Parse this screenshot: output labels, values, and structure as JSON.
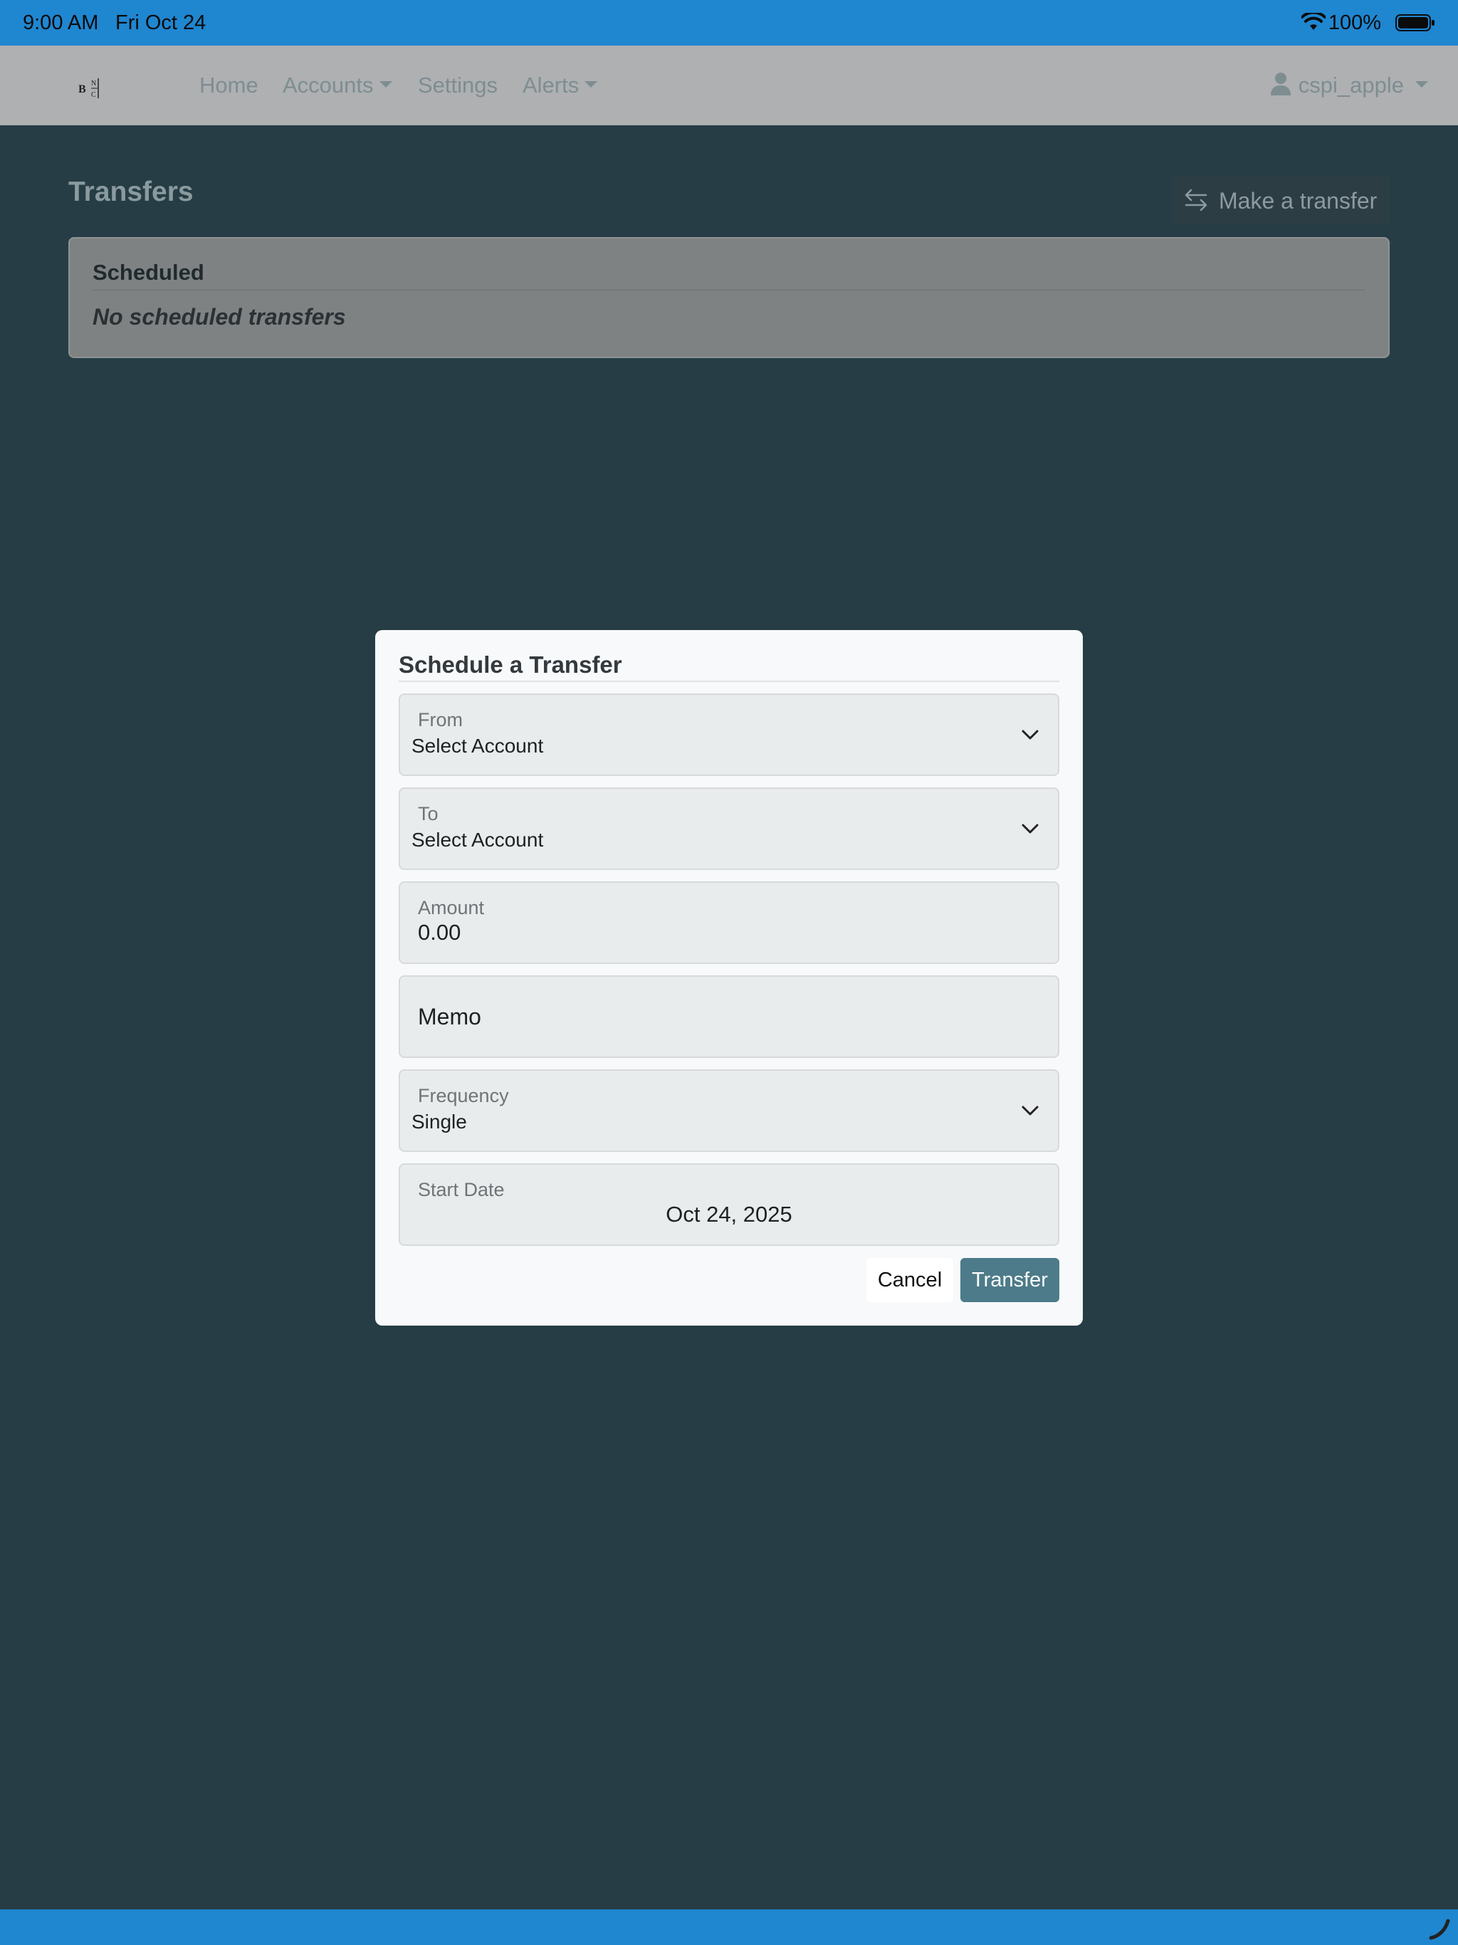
{
  "status_bar": {
    "time": "9:00 AM",
    "date": "Fri Oct 24",
    "battery_percent": "100%",
    "icons": [
      "wifi-icon",
      "battery-icon"
    ]
  },
  "nav": {
    "logo_icon": "bank-logo-icon",
    "items": [
      {
        "label": "Home"
      },
      {
        "label": "Accounts"
      },
      {
        "label": "Settings"
      },
      {
        "label": "Alerts"
      }
    ],
    "user": "cspi_apple",
    "user_icon": "person-icon"
  },
  "page": {
    "title": "Transfers",
    "make_transfer_label": "Make a transfer",
    "scheduled_header": "Scheduled",
    "scheduled_empty": "No scheduled transfers"
  },
  "modal": {
    "title": "Schedule a Transfer",
    "from": {
      "label": "From",
      "value": "Select Account"
    },
    "to": {
      "label": "To",
      "value": "Select Account"
    },
    "amount": {
      "label": "Amount",
      "value": "0.00"
    },
    "memo": {
      "placeholder": "Memo"
    },
    "frequency": {
      "label": "Frequency",
      "value": "Single"
    },
    "start_date": {
      "label": "Start Date",
      "value": "Oct 24, 2025"
    },
    "cancel_label": "Cancel",
    "transfer_label": "Transfer"
  },
  "colors": {
    "status_bar": "#1f86d0",
    "backdrop": "#263d45",
    "primary_button": "#4d7b89"
  }
}
